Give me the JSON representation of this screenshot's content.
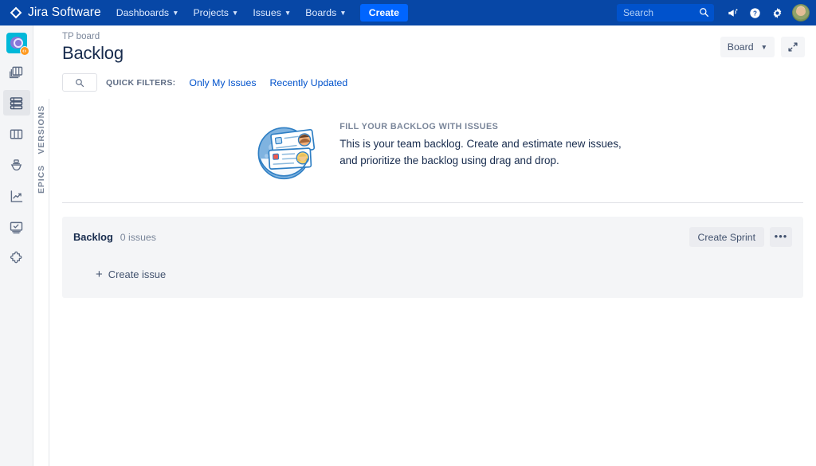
{
  "topnav": {
    "brand": "Jira Software",
    "brand_icon": "jira-logo-icon",
    "links": [
      {
        "label": "Dashboards"
      },
      {
        "label": "Projects"
      },
      {
        "label": "Issues"
      },
      {
        "label": "Boards"
      }
    ],
    "create_label": "Create",
    "search_placeholder": "Search",
    "icons": [
      {
        "name": "announcement-icon"
      },
      {
        "name": "help-icon"
      },
      {
        "name": "settings-gear-icon"
      }
    ],
    "avatar": "user-avatar",
    "colors": {
      "bar": "#0747A6",
      "create": "#0065FF",
      "search": "#0052CC"
    }
  },
  "rail": {
    "project_avatar": "project-avatar-icon",
    "project_badge": "‹›",
    "items": [
      {
        "name": "backlog-stack-icon",
        "active": false
      },
      {
        "name": "sprint-board-icon",
        "active": true
      },
      {
        "name": "board-columns-icon",
        "active": false
      },
      {
        "name": "releases-ship-icon",
        "active": false
      },
      {
        "name": "reports-chart-icon",
        "active": false
      },
      {
        "name": "project-pages-icon",
        "active": false
      },
      {
        "name": "add-ons-puzzle-icon",
        "active": false
      }
    ]
  },
  "side_strip": {
    "versions_label": "VERSIONS",
    "epics_label": "EPICS"
  },
  "header": {
    "breadcrumb": "TP board",
    "title": "Backlog",
    "board_button": "Board",
    "fullscreen_icon": "expand-fullscreen-icon"
  },
  "filters": {
    "search_icon": "search-icon",
    "quick_filters_label": "QUICK FILTERS:",
    "links": [
      {
        "label": "Only My Issues"
      },
      {
        "label": "Recently Updated"
      }
    ]
  },
  "empty_state": {
    "illustration": "backlog-cards-illustration",
    "kicker": "FILL YOUR BACKLOG WITH ISSUES",
    "line1": "This is your team backlog. Create and estimate new issues,",
    "line2": "and prioritize the backlog using drag and drop."
  },
  "backlog": {
    "title": "Backlog",
    "count": "0 issues",
    "create_sprint_label": "Create Sprint",
    "more_label": "•••",
    "create_issue_label": "Create issue",
    "plus": "+",
    "panel_color": "#F4F5F7"
  }
}
